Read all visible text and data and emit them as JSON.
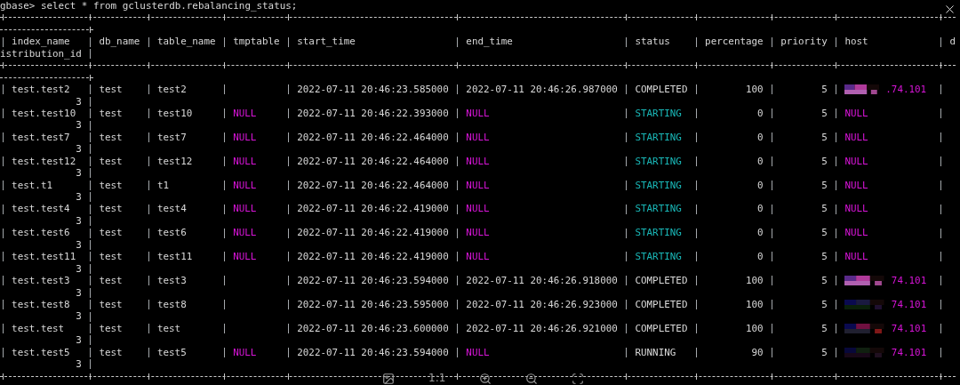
{
  "terminal": {
    "command_line": "gbase> select * from gclusterdb.rebalancing_status;",
    "columns": [
      {
        "name": "index_name"
      },
      {
        "name": "db_name"
      },
      {
        "name": "table_name"
      },
      {
        "name": "tmptable"
      },
      {
        "name": "start_time"
      },
      {
        "name": "end_time"
      },
      {
        "name": "status"
      },
      {
        "name": "percentage"
      },
      {
        "name": "priority"
      },
      {
        "name": "host"
      },
      {
        "name_start": "d",
        "name_rest": "istribution_id"
      }
    ],
    "rows": [
      [
        {
          "kind": "text",
          "text": "test.test2"
        },
        {
          "kind": "text",
          "text": "test"
        },
        {
          "kind": "text",
          "text": "test2"
        },
        {
          "kind": "blank"
        },
        {
          "kind": "text",
          "text": "2022-07-11 20:46:23.585000"
        },
        {
          "kind": "text",
          "text": "2022-07-11 20:46:26.987000"
        },
        {
          "kind": "status",
          "text": "COMPLETED",
          "color": "#d8d8d8"
        },
        {
          "kind": "number",
          "text": "100"
        },
        {
          "kind": "number",
          "text": "5"
        },
        {
          "kind": "host",
          "text": ".74.101"
        },
        {
          "kind": "number",
          "text": "3"
        }
      ],
      [
        {
          "kind": "text",
          "text": "test.test10"
        },
        {
          "kind": "text",
          "text": "test"
        },
        {
          "kind": "text",
          "text": "test10"
        },
        {
          "kind": "null",
          "text": "NULL"
        },
        {
          "kind": "text",
          "text": "2022-07-11 20:46:22.393000"
        },
        {
          "kind": "null",
          "text": "NULL"
        },
        {
          "kind": "status",
          "text": "STARTING",
          "color": "#19b8b8"
        },
        {
          "kind": "number",
          "text": "0"
        },
        {
          "kind": "number",
          "text": "5"
        },
        {
          "kind": "null",
          "text": "NULL"
        },
        {
          "kind": "number",
          "text": "3"
        }
      ],
      [
        {
          "kind": "text",
          "text": "test.test7"
        },
        {
          "kind": "text",
          "text": "test"
        },
        {
          "kind": "text",
          "text": "test7"
        },
        {
          "kind": "null",
          "text": "NULL"
        },
        {
          "kind": "text",
          "text": "2022-07-11 20:46:22.464000"
        },
        {
          "kind": "null",
          "text": "NULL"
        },
        {
          "kind": "status",
          "text": "STARTING",
          "color": "#19b8b8"
        },
        {
          "kind": "number",
          "text": "0"
        },
        {
          "kind": "number",
          "text": "5"
        },
        {
          "kind": "null",
          "text": "NULL"
        },
        {
          "kind": "number",
          "text": "3"
        }
      ],
      [
        {
          "kind": "text",
          "text": "test.test12"
        },
        {
          "kind": "text",
          "text": "test"
        },
        {
          "kind": "text",
          "text": "test12"
        },
        {
          "kind": "null",
          "text": "NULL"
        },
        {
          "kind": "text",
          "text": "2022-07-11 20:46:22.464000"
        },
        {
          "kind": "null",
          "text": "NULL"
        },
        {
          "kind": "status",
          "text": "STARTING",
          "color": "#19b8b8"
        },
        {
          "kind": "number",
          "text": "0"
        },
        {
          "kind": "number",
          "text": "5"
        },
        {
          "kind": "null",
          "text": "NULL"
        },
        {
          "kind": "number",
          "text": "3"
        }
      ],
      [
        {
          "kind": "text",
          "text": "test.t1"
        },
        {
          "kind": "text",
          "text": "test"
        },
        {
          "kind": "text",
          "text": "t1"
        },
        {
          "kind": "null",
          "text": "NULL"
        },
        {
          "kind": "text",
          "text": "2022-07-11 20:46:22.464000"
        },
        {
          "kind": "null",
          "text": "NULL"
        },
        {
          "kind": "status",
          "text": "STARTING",
          "color": "#19b8b8"
        },
        {
          "kind": "number",
          "text": "0"
        },
        {
          "kind": "number",
          "text": "5"
        },
        {
          "kind": "null",
          "text": "NULL"
        },
        {
          "kind": "number",
          "text": "3"
        }
      ],
      [
        {
          "kind": "text",
          "text": "test.test4"
        },
        {
          "kind": "text",
          "text": "test"
        },
        {
          "kind": "text",
          "text": "test4"
        },
        {
          "kind": "null",
          "text": "NULL"
        },
        {
          "kind": "text",
          "text": "2022-07-11 20:46:22.419000"
        },
        {
          "kind": "null",
          "text": "NULL"
        },
        {
          "kind": "status",
          "text": "STARTING",
          "color": "#19b8b8"
        },
        {
          "kind": "number",
          "text": "0"
        },
        {
          "kind": "number",
          "text": "5"
        },
        {
          "kind": "null",
          "text": "NULL"
        },
        {
          "kind": "number",
          "text": "3"
        }
      ],
      [
        {
          "kind": "text",
          "text": "test.test6"
        },
        {
          "kind": "text",
          "text": "test"
        },
        {
          "kind": "text",
          "text": "test6"
        },
        {
          "kind": "null",
          "text": "NULL"
        },
        {
          "kind": "text",
          "text": "2022-07-11 20:46:22.419000"
        },
        {
          "kind": "null",
          "text": "NULL"
        },
        {
          "kind": "status",
          "text": "STARTING",
          "color": "#19b8b8"
        },
        {
          "kind": "number",
          "text": "0"
        },
        {
          "kind": "number",
          "text": "5"
        },
        {
          "kind": "null",
          "text": "NULL"
        },
        {
          "kind": "number",
          "text": "3"
        }
      ],
      [
        {
          "kind": "text",
          "text": "test.test11"
        },
        {
          "kind": "text",
          "text": "test"
        },
        {
          "kind": "text",
          "text": "test11"
        },
        {
          "kind": "null",
          "text": "NULL"
        },
        {
          "kind": "text",
          "text": "2022-07-11 20:46:22.419000"
        },
        {
          "kind": "null",
          "text": "NULL"
        },
        {
          "kind": "status",
          "text": "STARTING",
          "color": "#19b8b8"
        },
        {
          "kind": "number",
          "text": "0"
        },
        {
          "kind": "number",
          "text": "5"
        },
        {
          "kind": "null",
          "text": "NULL"
        },
        {
          "kind": "number",
          "text": "3"
        }
      ],
      [
        {
          "kind": "text",
          "text": "test.test3"
        },
        {
          "kind": "text",
          "text": "test"
        },
        {
          "kind": "text",
          "text": "test3"
        },
        {
          "kind": "blank"
        },
        {
          "kind": "text",
          "text": "2022-07-11 20:46:23.594000"
        },
        {
          "kind": "text",
          "text": "2022-07-11 20:46:26.918000"
        },
        {
          "kind": "status",
          "text": "COMPLETED",
          "color": "#d8d8d8"
        },
        {
          "kind": "number",
          "text": "100"
        },
        {
          "kind": "number",
          "text": "5"
        },
        {
          "kind": "host",
          "text": "74.101"
        },
        {
          "kind": "number",
          "text": "3"
        }
      ],
      [
        {
          "kind": "text",
          "text": "test.test8"
        },
        {
          "kind": "text",
          "text": "test"
        },
        {
          "kind": "text",
          "text": "test8"
        },
        {
          "kind": "blank"
        },
        {
          "kind": "text",
          "text": "2022-07-11 20:46:23.595000"
        },
        {
          "kind": "text",
          "text": "2022-07-11 20:46:26.923000"
        },
        {
          "kind": "status",
          "text": "COMPLETED",
          "color": "#d8d8d8"
        },
        {
          "kind": "number",
          "text": "100"
        },
        {
          "kind": "number",
          "text": "5"
        },
        {
          "kind": "host",
          "text": "74.101"
        },
        {
          "kind": "number",
          "text": "3"
        }
      ],
      [
        {
          "kind": "text",
          "text": "test.test"
        },
        {
          "kind": "text",
          "text": "test"
        },
        {
          "kind": "text",
          "text": "test"
        },
        {
          "kind": "blank"
        },
        {
          "kind": "text",
          "text": "2022-07-11 20:46:23.600000"
        },
        {
          "kind": "text",
          "text": "2022-07-11 20:46:26.921000"
        },
        {
          "kind": "status",
          "text": "COMPLETED",
          "color": "#d8d8d8"
        },
        {
          "kind": "number",
          "text": "100"
        },
        {
          "kind": "number",
          "text": "5"
        },
        {
          "kind": "host",
          "text": "74.101"
        },
        {
          "kind": "number",
          "text": "3"
        }
      ],
      [
        {
          "kind": "text",
          "text": "test.test5"
        },
        {
          "kind": "text",
          "text": "test"
        },
        {
          "kind": "text",
          "text": "test5"
        },
        {
          "kind": "null",
          "text": "NULL"
        },
        {
          "kind": "text",
          "text": "2022-07-11 20:46:23.594000"
        },
        {
          "kind": "null",
          "text": "NULL"
        },
        {
          "kind": "status",
          "text": "RUNNING",
          "color": "#d8d8d8"
        },
        {
          "kind": "number",
          "text": "90"
        },
        {
          "kind": "number",
          "text": "5"
        },
        {
          "kind": "host",
          "text": "74.101"
        },
        {
          "kind": "number",
          "text": "3"
        }
      ]
    ]
  },
  "viewer_toolbar": {
    "ratio_label": "1:1"
  }
}
